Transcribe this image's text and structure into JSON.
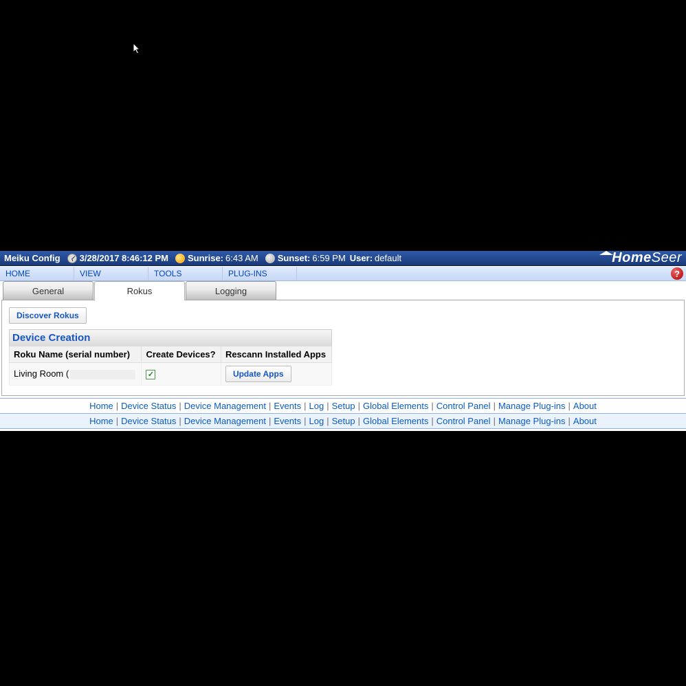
{
  "status": {
    "title": "Meiku Config",
    "datetime": "3/28/2017 8:46:12 PM",
    "sunrise_label": "Sunrise:",
    "sunrise": "6:43 AM",
    "sunset_label": "Sunset:",
    "sunset": "6:59 PM",
    "user_label": "User:",
    "user": "default"
  },
  "brand": {
    "name1": "Home",
    "name2": "Seer"
  },
  "nav": {
    "home": "HOME",
    "view": "VIEW",
    "tools": "TOOLS",
    "plugins": "PLUG-INS"
  },
  "tabs": {
    "general": "General",
    "rokus": "Rokus",
    "logging": "Logging",
    "active": "rokus"
  },
  "panel": {
    "discover_btn": "Discover Rokus",
    "section_title": "Device Creation",
    "cols": {
      "name": "Roku Name (serial number)",
      "create": "Create Devices?",
      "rescan": "Rescann Installed Apps"
    },
    "row": {
      "name_prefix": "Living Room (",
      "create_checked": true,
      "update_btn": "Update Apps"
    }
  },
  "footer_links": [
    "Home",
    "Device Status",
    "Device Management",
    "Events",
    "Log",
    "Setup",
    "Global Elements",
    "Control Panel",
    "Manage Plug-ins",
    "About"
  ]
}
